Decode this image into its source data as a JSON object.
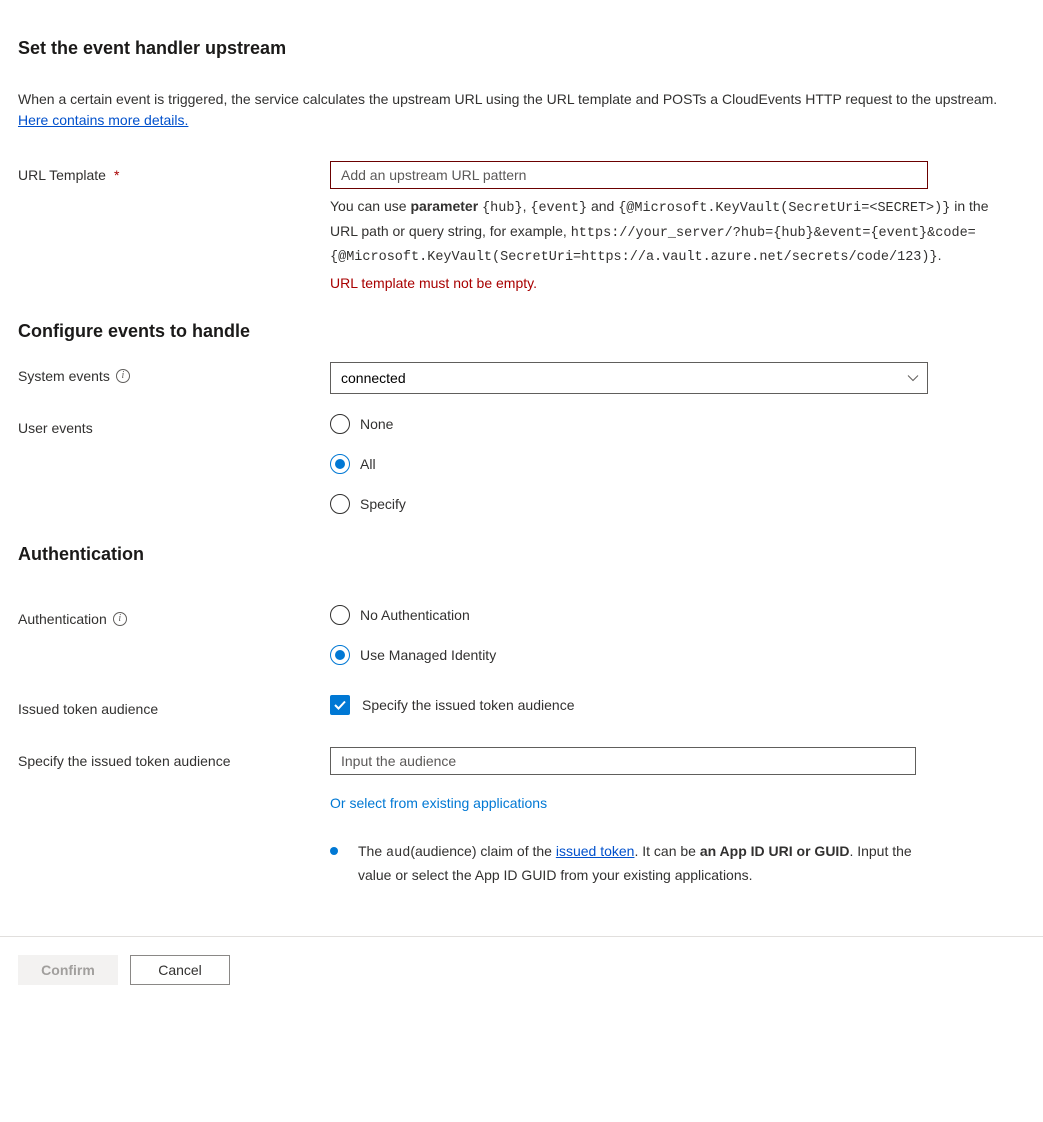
{
  "header": {
    "title": "Set the event handler upstream",
    "intro_before_link": "When a certain event is triggered, the service calculates the upstream URL using the URL template and POSTs a CloudEvents HTTP request to the upstream. ",
    "intro_link": "Here contains more details."
  },
  "url_template": {
    "label": "URL Template",
    "required_mark": "*",
    "placeholder": "Add an upstream URL pattern",
    "value": "",
    "help_prefix": "You can use ",
    "help_param_word": "parameter",
    "help_mid1": " ",
    "help_code1": "{hub}",
    "help_mid2": ", ",
    "help_code2": "{event}",
    "help_mid3": " and ",
    "help_code3": "{@Microsoft.KeyVault(SecretUri=<SECRET>)}",
    "help_mid4": " in the URL path or query string, for example, ",
    "help_code4": "https://your_server/?hub={hub}&event={event}&code={@Microsoft.KeyVault(SecretUri=https://a.vault.azure.net/secrets/code/123)}",
    "help_tail": ".",
    "error": "URL template must not be empty."
  },
  "events": {
    "heading": "Configure events to handle",
    "system_label": "System events",
    "system_selected": "connected",
    "user_label": "User events",
    "user_options": {
      "none": "None",
      "all": "All",
      "specify": "Specify"
    },
    "user_selected": "all"
  },
  "auth": {
    "heading": "Authentication",
    "label": "Authentication",
    "options": {
      "none": "No Authentication",
      "managed": "Use Managed Identity"
    },
    "selected": "managed",
    "issued_label": "Issued token audience",
    "specify_checked": true,
    "specify_label": "Specify the issued token audience",
    "audience_field_label": "Specify the issued token audience",
    "audience_placeholder": "Input the audience",
    "audience_value": "",
    "select_existing": "Or select from existing applications",
    "info_pre": "The ",
    "info_code": "aud",
    "info_mid1": "(audience) claim of the ",
    "info_link": "issued token",
    "info_mid2": ". It can be ",
    "info_bold": "an App ID URI or GUID",
    "info_tail": ". Input the value or select the App ID GUID from your existing applications."
  },
  "footer": {
    "confirm": "Confirm",
    "cancel": "Cancel"
  }
}
